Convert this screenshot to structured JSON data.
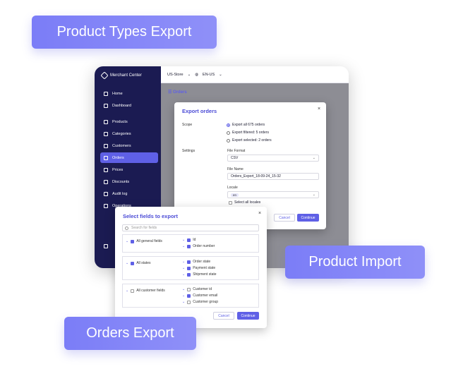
{
  "pills": {
    "product_types_export": "Product Types Export",
    "product_import": "Product Import",
    "orders_export": "Orders Export"
  },
  "app": {
    "brand": "Merchant Center",
    "store": "US-Store",
    "locale": "EN-US",
    "page_title": "Orders"
  },
  "sidebar": {
    "items": [
      {
        "label": "Home"
      },
      {
        "label": "Dashboard"
      },
      {
        "label": "Products"
      },
      {
        "label": "Categories"
      },
      {
        "label": "Customers"
      },
      {
        "label": "Orders"
      },
      {
        "label": "Prices"
      },
      {
        "label": "Discounts"
      },
      {
        "label": "Audit log"
      },
      {
        "label": "Operations"
      }
    ]
  },
  "export_modal": {
    "title": "Export orders",
    "scope_label": "Scope",
    "scope_options": [
      "Export all 675 orders",
      "Export filtered: 5 orders",
      "Export selected: 2 orders"
    ],
    "settings_label": "Settings",
    "file_format_label": "File Format",
    "file_format_value": "CSV",
    "file_name_label": "File Name",
    "file_name_value": "Orders_Export_18-09-24_15-32",
    "locale_label": "Locale",
    "locale_chip": "en",
    "select_all_locales": "Select all locales",
    "cancel": "Cancel",
    "continue": "Continue"
  },
  "fields_modal": {
    "title": "Select fields to export",
    "search_placeholder": "Search for fields",
    "groups": [
      {
        "name": "All general fields",
        "fields": [
          "Id",
          "Order number"
        ]
      },
      {
        "name": "All states",
        "fields": [
          "Order state",
          "Payment state",
          "Shipment state"
        ]
      },
      {
        "name": "All customer fields",
        "fields": [
          "Customer id",
          "Customer email",
          "Customer group"
        ]
      }
    ],
    "cancel": "Cancel",
    "continue": "Continue"
  },
  "colors": {
    "accent": "#5f60e6",
    "sidebar_bg": "#1b1b52",
    "pill_bg": "#8182f7"
  }
}
